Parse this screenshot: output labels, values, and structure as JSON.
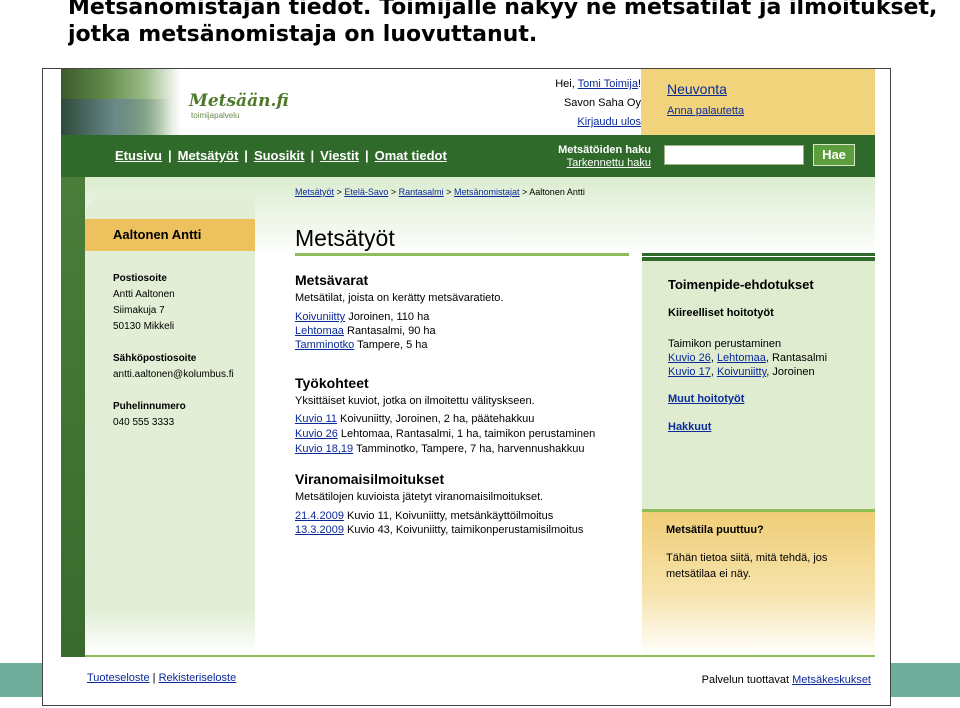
{
  "slide": {
    "title_line1": "Metsänomistajan tiedot. Toimijalle näkyy ne metsätilat ja ilmoitukset,",
    "title_line2": "jotka metsänomistaja on luovuttanut."
  },
  "header": {
    "logo": "Metsään.fi",
    "logo_sub": "toimijapalvelu",
    "greeting_prefix": "Hei, ",
    "user_name": "Tomi Toimija",
    "greeting_suffix": "!",
    "company": "Savon Saha Oy",
    "logout": "Kirjaudu ulos",
    "help": "Neuvonta",
    "feedback": "Anna palautetta"
  },
  "nav": {
    "items": [
      "Etusivu",
      "Metsätyöt",
      "Suosikit",
      "Viestit",
      "Omat tiedot"
    ],
    "separator": "|",
    "search_title": "Metsätöiden haku",
    "advanced_search": "Tarkennettu haku",
    "search_placeholder": "",
    "search_button": "Hae"
  },
  "owner": {
    "name": "Aaltonen Antti",
    "postal_label": "Postiosoite",
    "postal_lines": [
      "Antti Aaltonen",
      "Siimakuja 7",
      "50130 Mikkeli"
    ],
    "email_label": "Sähköpostiosoite",
    "email": "antti.aaltonen@kolumbus.fi",
    "phone_label": "Puhelinnumero",
    "phone": "040 555 3333"
  },
  "breadcrumb": {
    "items": [
      "Metsätyöt",
      "Etelä-Savo",
      "Rantasalmi",
      "Metsänomistajat"
    ],
    "separator": ">",
    "current": "Aaltonen Antti"
  },
  "main": {
    "page_title": "Metsätyöt",
    "resources_title": "Metsävarat",
    "resources_desc": "Metsätilat, joista on kerätty metsävaratieto.",
    "resources": [
      {
        "link": "Koivuniitty",
        "text": " Joroinen, 110 ha"
      },
      {
        "link": "Lehtomaa",
        "text": " Rantasalmi, 90 ha"
      },
      {
        "link": "Tamminotko",
        "text": " Tampere, 5 ha"
      }
    ],
    "targets_title": "Työkohteet",
    "targets_desc": "Yksittäiset kuviot, jotka on ilmoitettu välityskseen.",
    "targets": [
      {
        "link": "Kuvio 11",
        "text": " Koivuniitty, Joroinen, 2 ha, päätehakkuu"
      },
      {
        "link": "Kuvio 26",
        "text": " Lehtomaa, Rantasalmi, 1 ha, taimikon perustaminen"
      },
      {
        "link": "Kuvio 18,19",
        "text": " Tamminotko, Tampere, 7 ha, harvennushakkuu"
      }
    ],
    "notices_title": "Viranomaisilmoitukset",
    "notices_desc": "Metsätilojen kuvioista jätetyt viranomaisilmoitukset.",
    "notices": [
      {
        "link": "21.4.2009",
        "text": " Kuvio 11, Koivuniitty, metsänkäyttöilmoitus"
      },
      {
        "link": "13.3.2009",
        "text": " Kuvio 43, Koivuniitty, taimikonperustamisilmoitus"
      }
    ]
  },
  "sidebar": {
    "title": "Toimenpide-ehdotukset",
    "subtitle": "Kiireelliset hoitotyöt",
    "task": "Taimikon perustaminen",
    "row1_link1": "Kuvio 26",
    "row1_link2": "Lehtomaa",
    "row1_text": ", Rantasalmi",
    "row2_link1": "Kuvio 17",
    "row2_link2": "Koivuniitty",
    "row2_text": ", Joroinen",
    "other_tasks": "Muut hoitotyöt",
    "harvests": "Hakkuut",
    "missing_title": "Metsätila puuttuu?",
    "missing_text": "Tähän tietoa siitä, mitä tehdä, jos metsätilaa ei näy."
  },
  "footer": {
    "product_desc": "Tuoteseloste",
    "register_desc": "Rekisteriseloste",
    "provider_prefix": "Palvelun tuottavat ",
    "provider_link": "Metsäkeskukset"
  },
  "colors": {
    "nav_green": "#2f6a2a",
    "accent_yellow": "#f1d37c",
    "link_blue": "#0b2a9a",
    "light_green": "#dfeccf"
  }
}
